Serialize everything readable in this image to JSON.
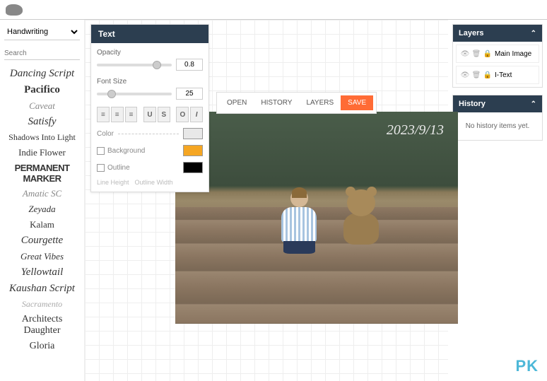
{
  "fontCategory": "Handwriting",
  "searchPlaceholder": "Search",
  "fonts": [
    "Dancing Script",
    "Pacifico",
    "Caveat",
    "Satisfy",
    "Shadows Into Light",
    "Indie Flower",
    "Permanent Marker",
    "Amatic SC",
    "Zeyada",
    "Kalam",
    "Courgette",
    "Great Vibes",
    "Yellowtail",
    "Kaushan Script",
    "Sacramento",
    "Architects Daughter",
    "Gloria"
  ],
  "textPanel": {
    "title": "Text",
    "opacityLabel": "Opacity",
    "opacityValue": "0.8",
    "opacityPct": 80,
    "fontSizeLabel": "Font Size",
    "fontSizeValue": "25",
    "fontSizePct": 20,
    "colorLabel": "Color",
    "colorSwatch": "#e8e8e8",
    "backgroundLabel": "Background",
    "backgroundSwatch": "#f5a623",
    "outlineLabel": "Outline",
    "outlineSwatch": "#000000",
    "lineHeightLabel": "Line Height",
    "outlineWidthLabel": "Outline Width"
  },
  "toolbar": {
    "open": "OPEN",
    "history": "HISTORY",
    "layers": "LAYERS",
    "save": "SAVE"
  },
  "canvasText": "2023/9/13",
  "layers": {
    "title": "Layers",
    "items": [
      "Main Image",
      "I-Text"
    ]
  },
  "history": {
    "title": "History",
    "empty": "No history items yet."
  },
  "watermark": "PK"
}
